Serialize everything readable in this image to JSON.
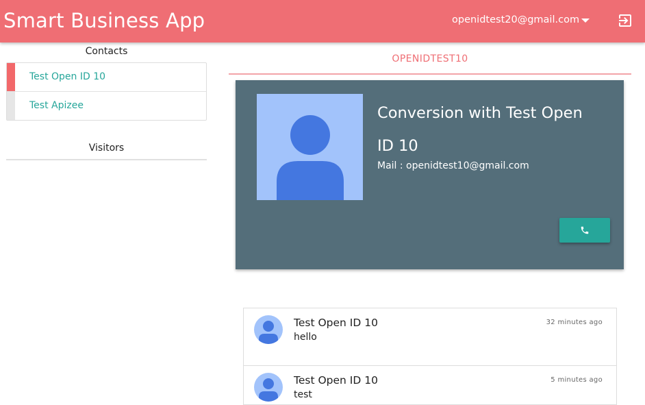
{
  "header": {
    "app_title": "Smart Business App",
    "user_email": "openidtest20@gmail.com",
    "menu_icon": "caret-down-icon",
    "logout_icon": "logout-icon"
  },
  "sidebar": {
    "contacts_title": "Contacts",
    "contacts": [
      {
        "name": "Test Open ID 10",
        "active": true
      },
      {
        "name": "Test Apizee",
        "active": false
      }
    ],
    "visitors_title": "Visitors"
  },
  "main": {
    "active_tab": "OPENIDTEST10",
    "profile": {
      "title": "Conversion with Test Open ID 10",
      "mail": "Mail : openidtest10@gmail.com",
      "call_icon": "phone-icon"
    },
    "messages": [
      {
        "author": "Test Open ID 10",
        "text": "hello",
        "time": "32 minutes ago"
      },
      {
        "author": "Test Open ID 10",
        "text": "test",
        "time": "5 minutes ago"
      }
    ]
  },
  "colors": {
    "primary": "#ef6e74",
    "accent": "#26a69a",
    "card": "#546e7a",
    "avatar_bg": "#a2c3fb",
    "avatar_fg": "#4477e0"
  }
}
